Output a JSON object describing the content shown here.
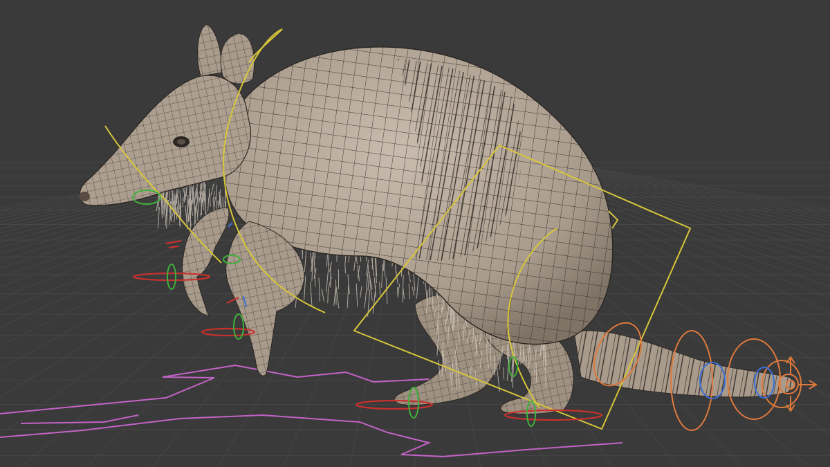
{
  "viewport": {
    "background_color": "#3a3a3a",
    "grid_color": "#464646",
    "mesh_fill_color": "#a89b8c",
    "mesh_wire_color": "#2b2622",
    "colors": {
      "body_bone": "#d8c63a",
      "ik_control": "#e07a3c",
      "motion_path": "#c463c8",
      "x_axis_ring": "#c8312d",
      "y_axis_ring": "#3fb13a",
      "z_axis_ring": "#3a70d8"
    }
  },
  "icons": {
    "gizmo_move": "move-arrows-icon"
  }
}
